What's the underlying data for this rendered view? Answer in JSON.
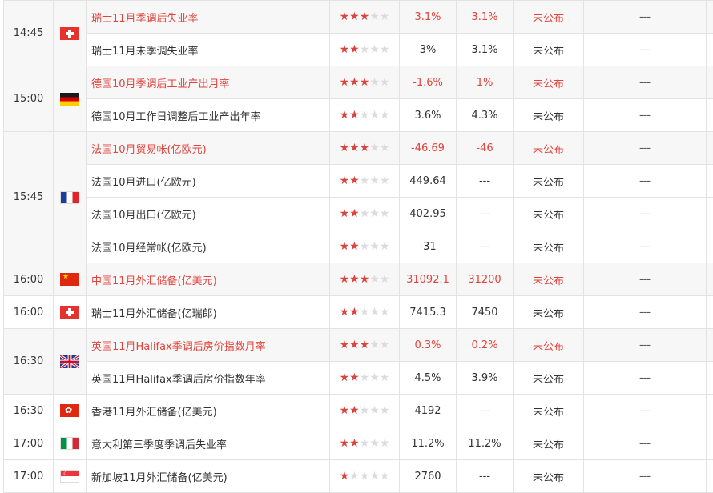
{
  "rows": [
    {
      "name": "瑞士11月季调后失业率",
      "stars": 3,
      "prev": "3.1%",
      "forecast": "3.1%",
      "status": "未公布",
      "more": "---"
    },
    {
      "name": "瑞士11月未季调失业率",
      "stars": 2,
      "prev": "3%",
      "forecast": "3.1%",
      "status": "未公布",
      "more": "---"
    },
    {
      "name": "德国10月季调后工业产出月率",
      "stars": 3,
      "prev": "-1.6%",
      "forecast": "1%",
      "status": "未公布",
      "more": "---"
    },
    {
      "name": "德国10月工作日调整后工业产出年率",
      "stars": 2,
      "prev": "3.6%",
      "forecast": "4.3%",
      "status": "未公布",
      "more": "---"
    },
    {
      "name": "法国10月贸易帐(亿欧元)",
      "stars": 3,
      "prev": "-46.69",
      "forecast": "-46",
      "status": "未公布",
      "more": "---"
    },
    {
      "name": "法国10月进口(亿欧元)",
      "stars": 2,
      "prev": "449.64",
      "forecast": "---",
      "status": "未公布",
      "more": "---"
    },
    {
      "name": "法国10月出口(亿欧元)",
      "stars": 2,
      "prev": "402.95",
      "forecast": "---",
      "status": "未公布",
      "more": "---"
    },
    {
      "name": "法国10月经常帐(亿欧元)",
      "stars": 2,
      "prev": "-31",
      "forecast": "---",
      "status": "未公布",
      "more": "---"
    },
    {
      "name": "中国11月外汇储备(亿美元)",
      "stars": 3,
      "prev": "31092.1",
      "forecast": "31200",
      "status": "未公布",
      "more": "---"
    },
    {
      "name": "瑞士11月外汇储备(亿瑞郎)",
      "stars": 2,
      "prev": "7415.3",
      "forecast": "7450",
      "status": "未公布",
      "more": "---"
    },
    {
      "name": "英国11月Halifax季调后房价指数月率",
      "stars": 3,
      "prev": "0.3%",
      "forecast": "0.2%",
      "status": "未公布",
      "more": "---"
    },
    {
      "name": "英国11月Halifax季调后房价指数年率",
      "stars": 2,
      "prev": "4.5%",
      "forecast": "3.9%",
      "status": "未公布",
      "more": "---"
    },
    {
      "name": "香港11月外汇储备(亿美元)",
      "stars": 2,
      "prev": "4192",
      "forecast": "---",
      "status": "未公布",
      "more": "---"
    },
    {
      "name": "意大利第三季度季调后失业率",
      "stars": 2,
      "prev": "11.2%",
      "forecast": "11.2%",
      "status": "未公布",
      "more": "---"
    },
    {
      "name": "新加坡11月外汇储备(亿美元)",
      "stars": 1,
      "prev": "2760",
      "forecast": "---",
      "status": "未公布",
      "more": "---"
    }
  ],
  "times": [
    "14:45",
    "15:00",
    "15:45",
    "16:00",
    "16:00",
    "16:30",
    "16:30",
    "17:00",
    "17:00"
  ],
  "flags": {
    "cn_glyph": "★",
    "hk_glyph": "✿",
    "sg_glyph": "☾"
  },
  "colors": {
    "highlight": "#e2433c",
    "star_on": "#d9443f",
    "star_off": "#dcdcdc",
    "chart_blue": "#6fa3e0"
  }
}
